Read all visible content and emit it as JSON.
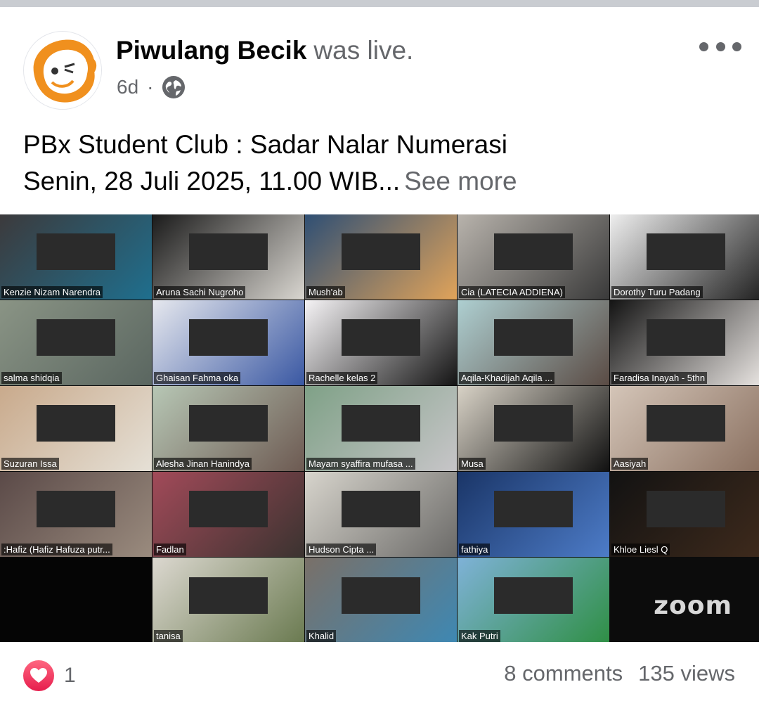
{
  "post": {
    "author": "Piwulang Becik",
    "author_suffix": "was live.",
    "time": "6d",
    "separator": "·",
    "privacy_icon": "globe-icon",
    "menu_icon": "more-dots-icon",
    "caption_line1": "PBx Student Club : Sadar Nalar Numerasi",
    "caption_line2": "Senin, 28 Juli 2025, 11.00 WIB...",
    "see_more": "See more"
  },
  "video": {
    "watermark": "zoom",
    "participants": [
      {
        "name": "Kenzie Nizam Narendra",
        "bg": "#3c3a3c",
        "bg2": "#1f6f8e"
      },
      {
        "name": "Aruna Sachi Nugroho",
        "bg": "#1b1b1b",
        "bg2": "#d9d6d0"
      },
      {
        "name": "Mush'ab",
        "bg": "#2f4f74",
        "bg2": "#e0a35a"
      },
      {
        "name": "Cia (LATECIA ADDIENA)",
        "bg": "#b8b3ac",
        "bg2": "#3a3a3a"
      },
      {
        "name": "Dorothy Turu Padang",
        "bg": "#eeeeee",
        "bg2": "#222222"
      },
      {
        "name": "salma shidqia",
        "bg": "#8a9485",
        "bg2": "#5a6660"
      },
      {
        "name": "Ghaisan Fahma oka",
        "bg": "#e6e8ee",
        "bg2": "#3a58a3"
      },
      {
        "name": "Rachelle kelas 2",
        "bg": "#f5f3f5",
        "bg2": "#141414"
      },
      {
        "name": "Aqila-Khadijah Aqila ...",
        "bg": "#aecfd1",
        "bg2": "#5a4b44"
      },
      {
        "name": "Faradisa Inayah - 5thn",
        "bg": "#141414",
        "bg2": "#e8e4e1"
      },
      {
        "name": "Suzuran Issa",
        "bg": "#c9aa8c",
        "bg2": "#e5e0d6"
      },
      {
        "name": "Alesha Jinan Hanindya",
        "bg": "#b7c7b5",
        "bg2": "#6d5a52"
      },
      {
        "name": "Mayam syaffira mufasa ...",
        "bg": "#7fa187",
        "bg2": "#c7c5c8"
      },
      {
        "name": "Musa",
        "bg": "#d8d2c6",
        "bg2": "#111111"
      },
      {
        "name": "Aasiyah",
        "bg": "#d4c5b8",
        "bg2": "#8a7060"
      },
      {
        "name": ":Hafiz (Hafiz Hafuza putr...",
        "bg": "#5b4a48",
        "bg2": "#9a8b7e"
      },
      {
        "name": "Fadlan",
        "bg": "#a24a59",
        "bg2": "#3b3330"
      },
      {
        "name": "Hudson Cipta ...",
        "bg": "#d7d4cc",
        "bg2": "#6b6a68"
      },
      {
        "name": "fathiya",
        "bg": "#1a3567",
        "bg2": "#4d7cc8"
      },
      {
        "name": "Khloe Liesl Q",
        "bg": "#121212",
        "bg2": "#3e2a1c"
      },
      {
        "name": "",
        "bg": "#050505",
        "bg2": "#050505"
      },
      {
        "name": "tanisa",
        "bg": "#dcd8d0",
        "bg2": "#6a7a50"
      },
      {
        "name": "Khalid",
        "bg": "#7a7068",
        "bg2": "#3e88b3"
      },
      {
        "name": "Kak Putri",
        "bg": "#7fb2d8",
        "bg2": "#2f8f45"
      },
      {
        "name": "",
        "bg": "#0c0c0c",
        "bg2": "#0c0c0c"
      }
    ]
  },
  "footer": {
    "reaction_icon": "heart-reaction-icon",
    "reaction_count": "1",
    "comments": "8 comments",
    "views": "135 views"
  }
}
